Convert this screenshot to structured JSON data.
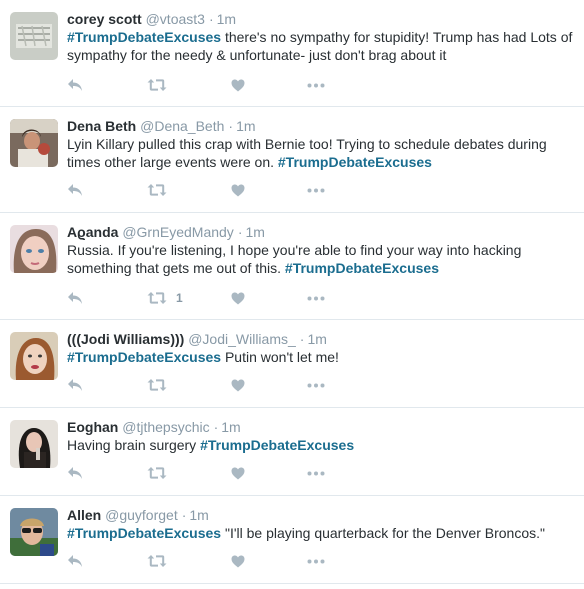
{
  "icons": {
    "reply": "reply-icon",
    "retweet": "retweet-icon",
    "like": "heart-icon",
    "more": "more-icon"
  },
  "colors": {
    "hashtag": "#1b6d8f",
    "meta": "#8899a6",
    "icon": "#aab8c2",
    "border": "#e1e8ed"
  },
  "tweets": [
    {
      "name": "corey scott",
      "handle": "@vtoast3",
      "time": "1m",
      "text_parts": [
        {
          "text": "#TrumpDebateExcuses",
          "hashtag": true
        },
        {
          "text": " there's no sympathy for stupidity! Trump has had Lots of sympathy for the needy & unfortunate- just don't brag about it",
          "hashtag": false
        }
      ],
      "retweet_count": ""
    },
    {
      "name": "Dena Beth",
      "handle": "@Dena_Beth",
      "time": "1m",
      "text_parts": [
        {
          "text": "Lyin Killary pulled this crap with Bernie too! Trying to schedule debates during times other large events were on. ",
          "hashtag": false
        },
        {
          "text": "#TrumpDebateExcuses",
          "hashtag": true
        }
      ],
      "retweet_count": ""
    },
    {
      "name": "Aϱanda",
      "handle": "@GrnEyedMandy",
      "time": "1m",
      "text_parts": [
        {
          "text": "Russia. If you're listening, I hope you're able to find your way into hacking something that gets me out of this. ",
          "hashtag": false
        },
        {
          "text": "#TrumpDebateExcuses",
          "hashtag": true
        }
      ],
      "retweet_count": "1"
    },
    {
      "name": "(((Jodi Williams)))",
      "handle": "@Jodi_Williams_",
      "time": "1m",
      "text_parts": [
        {
          "text": "#TrumpDebateExcuses",
          "hashtag": true
        },
        {
          "text": " Putin won't let me!",
          "hashtag": false
        }
      ],
      "retweet_count": ""
    },
    {
      "name": "Eoghan",
      "handle": "@tjthepsychic",
      "time": "1m",
      "text_parts": [
        {
          "text": "Having brain surgery ",
          "hashtag": false
        },
        {
          "text": "#TrumpDebateExcuses",
          "hashtag": true
        }
      ],
      "retweet_count": ""
    },
    {
      "name": "Allen",
      "handle": "@guyforget",
      "time": "1m",
      "text_parts": [
        {
          "text": "#TrumpDebateExcuses",
          "hashtag": true
        },
        {
          "text": " \"I'll be playing quarterback for the Denver Broncos.\"",
          "hashtag": false
        }
      ],
      "retweet_count": ""
    }
  ]
}
